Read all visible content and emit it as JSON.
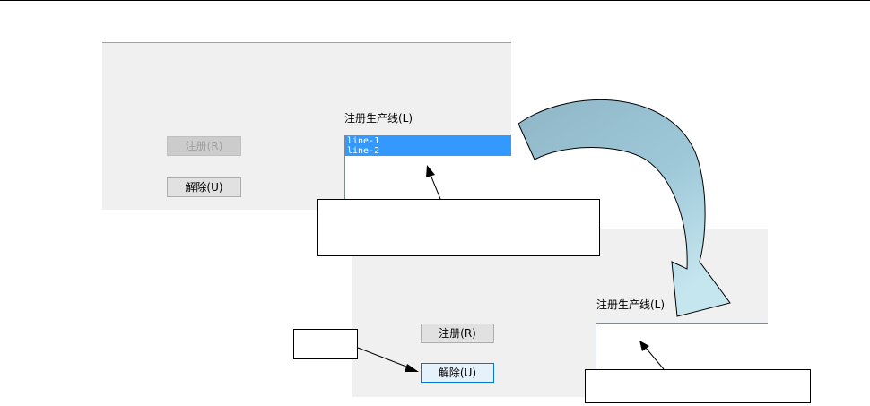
{
  "before": {
    "register_label": "注册(R)",
    "unregister_label": "解除(U)",
    "list_label": "注册生产线(L)",
    "list_items": [
      "line-1",
      "line-2"
    ]
  },
  "after": {
    "register_label": "注册(R)",
    "unregister_label": "解除(U)",
    "list_label": "注册生产线(L)",
    "list_items": []
  },
  "callouts": {
    "selected_lines": "",
    "unregister_click": "",
    "empty_list": ""
  },
  "colors": {
    "selection": "#3399ff",
    "arrow_fill": "#9ec8d8",
    "arrow_end_fill": "#c6e6ef"
  }
}
